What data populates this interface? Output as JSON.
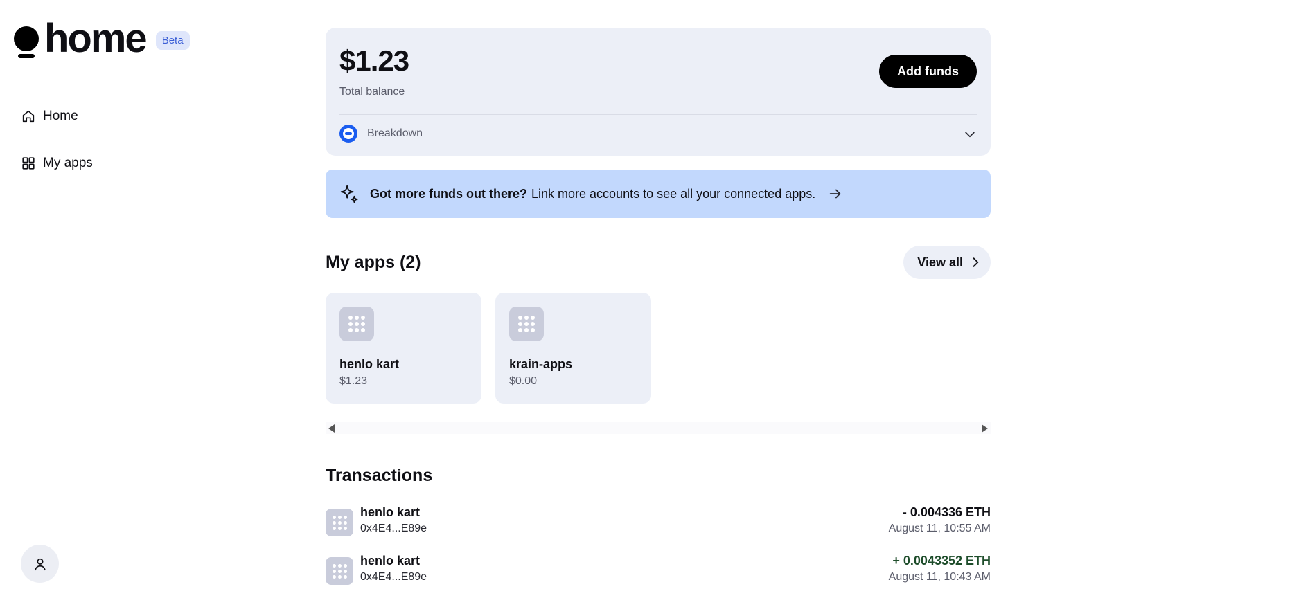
{
  "brand": {
    "name": "home",
    "badge": "Beta"
  },
  "sidebar": {
    "items": [
      {
        "label": "Home",
        "icon": "home-icon"
      },
      {
        "label": "My apps",
        "icon": "grid-icon"
      }
    ],
    "profile_icon": "user-icon"
  },
  "balance": {
    "amount": "$1.23",
    "label": "Total balance",
    "add_funds_label": "Add funds",
    "breakdown_label": "Breakdown"
  },
  "promo": {
    "strong": "Got more funds out there?",
    "text": "Link more accounts to see all your connected apps."
  },
  "apps": {
    "title": "My apps (2)",
    "view_all_label": "View all",
    "items": [
      {
        "name": "henlo kart",
        "balance": "$1.23"
      },
      {
        "name": "krain-apps",
        "balance": "$0.00"
      }
    ]
  },
  "transactions": {
    "title": "Transactions",
    "items": [
      {
        "name": "henlo kart",
        "address": "0x4E4...E89e",
        "amount": "- 0.004336 ETH",
        "date": "August 11, 10:55 AM"
      },
      {
        "name": "henlo kart",
        "address": "0x4E4...E89e",
        "amount": "+ 0.0043352 ETH",
        "date": "August 11, 10:43 AM"
      }
    ]
  },
  "colors": {
    "accent": "#1b5df0",
    "promo_bg": "#c2d8fd",
    "card_bg": "#eceff7",
    "positive": "#1e4d2b"
  }
}
